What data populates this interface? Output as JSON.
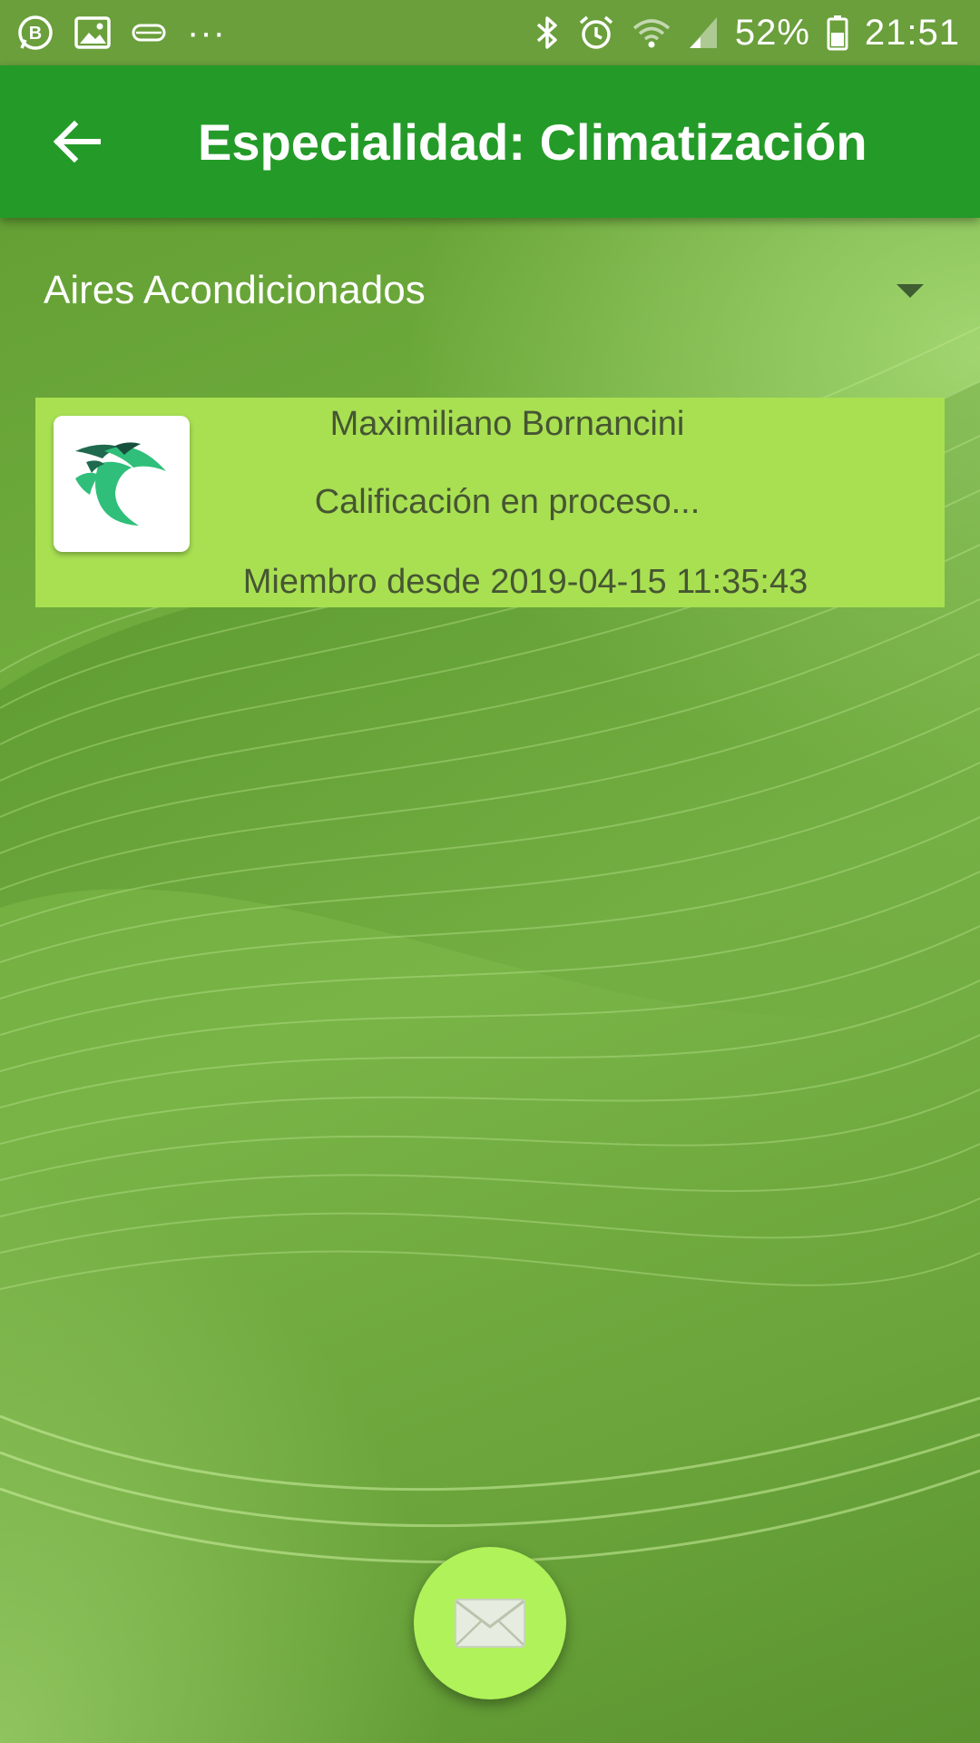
{
  "status_bar": {
    "battery_percent": "52%",
    "time": "21:51",
    "overflow": "···",
    "left_icons": [
      "whatsapp-business-icon",
      "gallery-icon",
      "tray-icon"
    ],
    "right_icons": [
      "bluetooth-icon",
      "alarm-icon",
      "wifi-icon",
      "signal-icon",
      "battery-icon"
    ]
  },
  "app_bar": {
    "title": "Especialidad: Climatización",
    "background": "#249b28"
  },
  "filter": {
    "selected": "Aires Acondicionados"
  },
  "providers": [
    {
      "name": "Maximiliano Bornancini",
      "rating_status": "Calificación en proceso...",
      "member_since": "Miembro desde 2019-04-15 11:35:43",
      "avatar_icon": "leaf-bird-logo-icon"
    }
  ],
  "fab": {
    "icon": "envelope-icon",
    "color": "#b0f25a"
  },
  "colors": {
    "card": "#a8e052",
    "card_text": "#465632"
  }
}
